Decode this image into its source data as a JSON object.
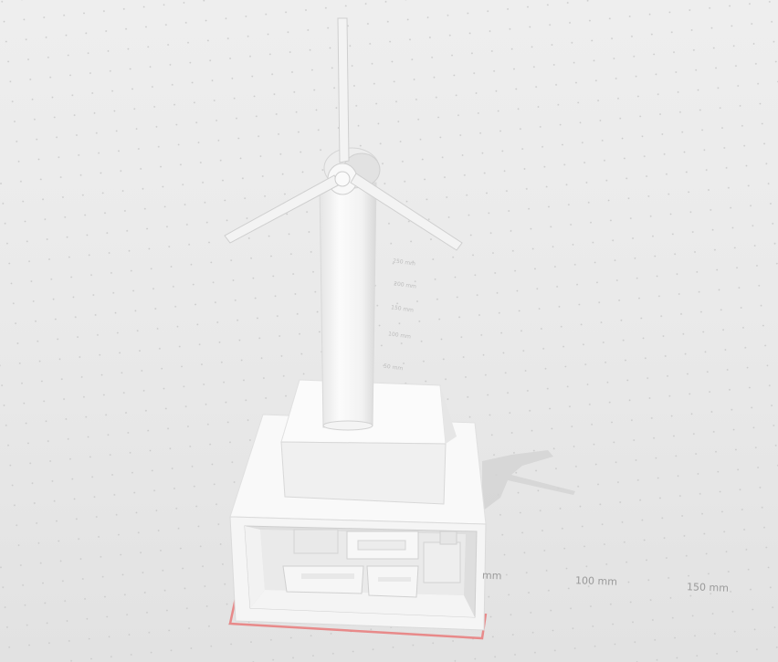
{
  "viewer": {
    "model_name": "wind-turbine-on-base",
    "ruler": {
      "labels_front": [
        "mm",
        "100 mm",
        "150 mm"
      ],
      "labels_vertical": [
        "250 mm",
        "200 mm",
        "150 mm",
        "100 mm",
        "50 mm"
      ]
    },
    "colors": {
      "background": "#ebebeb",
      "model": "#f7f7f7",
      "model_shade": "#dcdcdc",
      "build_outline": "#e57373",
      "shadow": "#cfcfcf"
    }
  }
}
